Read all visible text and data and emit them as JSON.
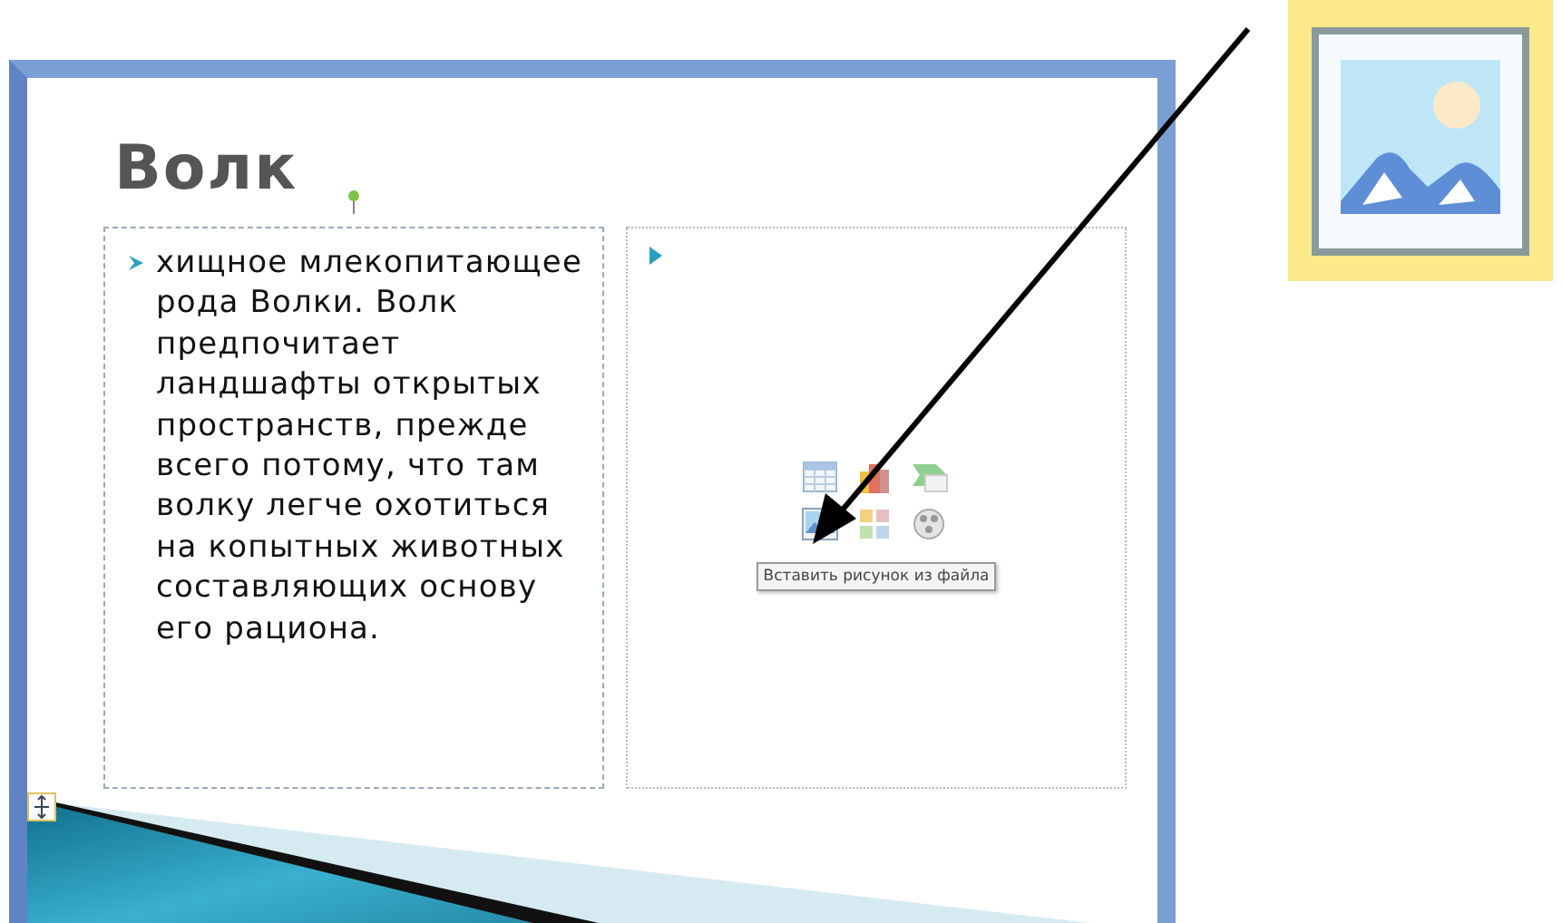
{
  "slide": {
    "title": "Волк",
    "text_placeholder": {
      "paragraph": "хищное млекопитающее рода Волки. Волк предпочитает ландшафты открытых пространств, прежде всего потому, что там волку легче охотиться на копытных животных составляющих основу его рациона."
    },
    "content_placeholder": {
      "insert_icons": [
        {
          "kind": "table"
        },
        {
          "kind": "chart"
        },
        {
          "kind": "smartart"
        },
        {
          "kind": "picture"
        },
        {
          "kind": "clipart"
        },
        {
          "kind": "media"
        }
      ],
      "tooltip": "Вставить рисунок из файла"
    }
  }
}
